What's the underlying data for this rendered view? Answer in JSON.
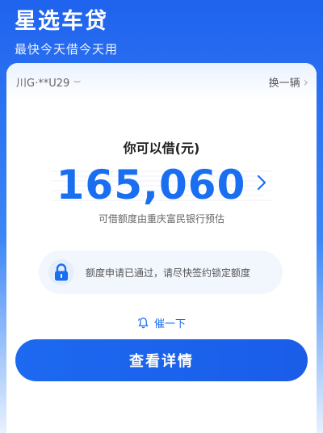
{
  "header": {
    "title": "星选车贷",
    "subtitle": "最快今天借今天用"
  },
  "vehicle": {
    "plate": "川G·**U29",
    "switch_label": "换一辆"
  },
  "loan": {
    "label": "你可以借(元)",
    "amount": "165,060",
    "note": "可借额度由重庆富民银行预估"
  },
  "status": {
    "message": "额度申请已通过，请尽快签约锁定额度"
  },
  "remind": {
    "label": "催一下"
  },
  "actions": {
    "details_label": "查看详情"
  },
  "colors": {
    "primary": "#1a6ff0",
    "header_bg": "#1f63ee"
  }
}
